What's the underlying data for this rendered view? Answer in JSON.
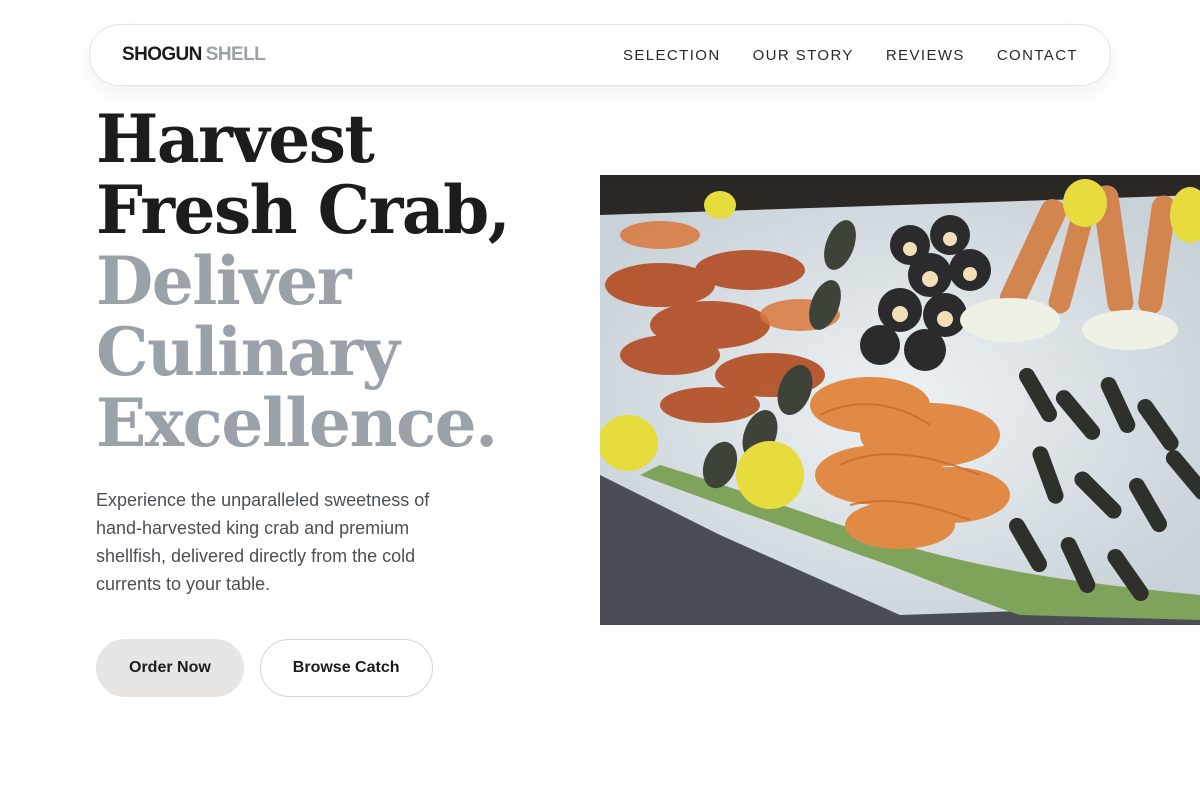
{
  "brand": {
    "name_primary": "SHOGUN",
    "name_secondary": "SHELL"
  },
  "nav": {
    "links": [
      "SELECTION",
      "OUR STORY",
      "REVIEWS",
      "CONTACT"
    ]
  },
  "hero": {
    "headline_dark_1": "Harvest",
    "headline_dark_2": "Fresh Crab,",
    "headline_muted_1": "Deliver",
    "headline_muted_2": "Culinary",
    "headline_muted_3": "Excellence.",
    "lede": "Experience the unparalleled sweetness of hand-harvested king crab and premium shellfish, delivered directly from the cold currents to your table.",
    "primary_cta": "Order Now",
    "secondary_cta": "Browse Catch"
  },
  "colors": {
    "text_dark": "#1c1c1c",
    "text_muted": "#9ba1a9",
    "primary_button_bg": "#e7e6e4",
    "border": "#e4e4e4"
  }
}
